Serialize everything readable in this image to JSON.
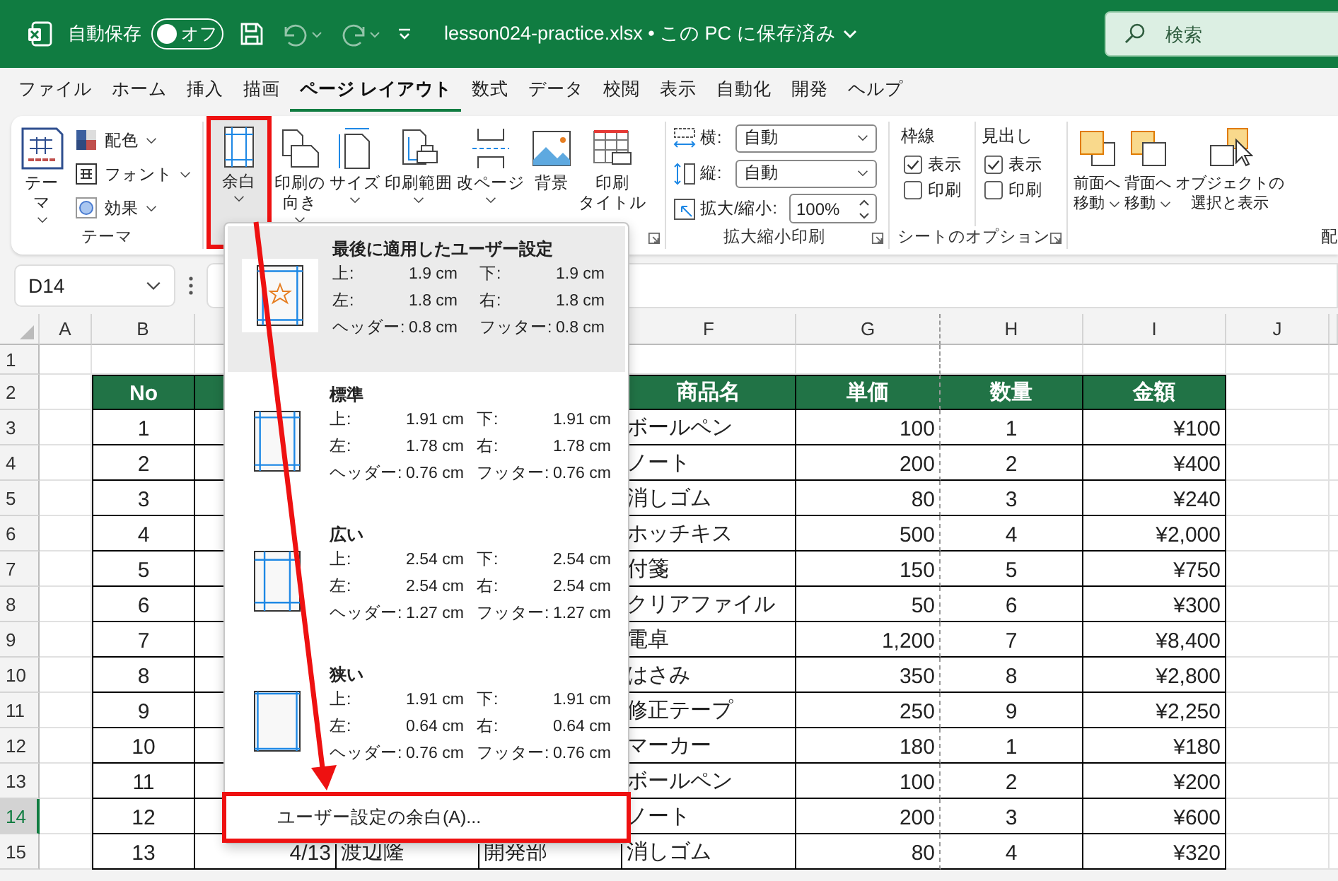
{
  "title_bar": {
    "autosave_label": "自動保存",
    "autosave": {
      "on": false,
      "state_label": "オフ"
    },
    "document": "lesson024-practice.xlsx • この PC に保存済み",
    "search": {
      "placeholder": "検索"
    }
  },
  "tabs": [
    {
      "label": "ファイル",
      "selected": false
    },
    {
      "label": "ホーム",
      "selected": false
    },
    {
      "label": "挿入",
      "selected": false
    },
    {
      "label": "描画",
      "selected": false
    },
    {
      "label": "ページ レイアウト",
      "selected": true
    },
    {
      "label": "数式",
      "selected": false
    },
    {
      "label": "データ",
      "selected": false
    },
    {
      "label": "校閲",
      "selected": false
    },
    {
      "label": "表示",
      "selected": false
    },
    {
      "label": "自動化",
      "selected": false
    },
    {
      "label": "開発",
      "selected": false
    },
    {
      "label": "ヘルプ",
      "selected": false
    }
  ],
  "ribbon": {
    "themes": {
      "big_button": "テーマ",
      "small_buttons": [
        "配色",
        "フォント",
        "効果"
      ],
      "label": "テーマ"
    },
    "page_setup": {
      "buttons": [
        {
          "lines": [
            "余白"
          ],
          "dropdown": true,
          "active": true
        },
        {
          "lines": [
            "印刷の",
            "向き"
          ],
          "dropdown": true,
          "active": false
        },
        {
          "lines": [
            "サイズ"
          ],
          "dropdown": true,
          "active": false
        },
        {
          "lines": [
            "印刷範囲"
          ],
          "dropdown": true,
          "active": false
        },
        {
          "lines": [
            "改ページ"
          ],
          "dropdown": true,
          "active": false
        },
        {
          "lines": [
            "背景"
          ],
          "dropdown": false,
          "active": false
        },
        {
          "lines": [
            "印刷",
            "タイトル"
          ],
          "dropdown": false,
          "active": false
        }
      ]
    },
    "scale": {
      "rows": [
        {
          "label": "横:",
          "value": "自動",
          "kind": "select"
        },
        {
          "label": "縦:",
          "value": "自動",
          "kind": "select"
        },
        {
          "label": "拡大/縮小:",
          "value": "100%",
          "kind": "spinner"
        }
      ],
      "label": "拡大縮小印刷"
    },
    "sheet_options": {
      "columns": [
        {
          "title": "枠線",
          "options": [
            {
              "label": "表示",
              "checked": true
            },
            {
              "label": "印刷",
              "checked": false
            }
          ]
        },
        {
          "title": "見出し",
          "options": [
            {
              "label": "表示",
              "checked": true
            },
            {
              "label": "印刷",
              "checked": false
            }
          ]
        }
      ],
      "label": "シートのオプション"
    },
    "arrange": {
      "buttons": [
        {
          "lines": [
            "前面へ",
            "移動"
          ],
          "dropdown": true
        },
        {
          "lines": [
            "背面へ",
            "移動"
          ],
          "dropdown": true
        },
        {
          "lines": [
            "オブジェクトの",
            "選択と表示"
          ],
          "dropdown": false
        }
      ],
      "label": "配"
    }
  },
  "formula_bar": {
    "name_box": "D14"
  },
  "sheet": {
    "column_headers": [
      "A",
      "B",
      "F",
      "G",
      "H",
      "I",
      "J"
    ],
    "rows": [
      {
        "num": "1",
        "kind": "blank",
        "selected": false
      },
      {
        "num": "2",
        "kind": "header",
        "selected": false,
        "no": "No",
        "product": "商品名",
        "price": "単価",
        "qty": "数量",
        "amount": "金額"
      },
      {
        "num": "3",
        "kind": "data",
        "selected": false,
        "no": "1",
        "product": "ボールペン",
        "price": "100",
        "qty": "1",
        "amount": "¥100"
      },
      {
        "num": "4",
        "kind": "data",
        "selected": false,
        "no": "2",
        "product": "ノート",
        "price": "200",
        "qty": "2",
        "amount": "¥400"
      },
      {
        "num": "5",
        "kind": "data",
        "selected": false,
        "no": "3",
        "product": "消しゴム",
        "price": "80",
        "qty": "3",
        "amount": "¥240"
      },
      {
        "num": "6",
        "kind": "data",
        "selected": false,
        "no": "4",
        "product": "ホッチキス",
        "price": "500",
        "qty": "4",
        "amount": "¥2,000"
      },
      {
        "num": "7",
        "kind": "data",
        "selected": false,
        "no": "5",
        "product": "付箋",
        "price": "150",
        "qty": "5",
        "amount": "¥750"
      },
      {
        "num": "8",
        "kind": "data",
        "selected": false,
        "no": "6",
        "product": "クリアファイル",
        "price": "50",
        "qty": "6",
        "amount": "¥300"
      },
      {
        "num": "9",
        "kind": "data",
        "selected": false,
        "no": "7",
        "product": "電卓",
        "price": "1,200",
        "qty": "7",
        "amount": "¥8,400"
      },
      {
        "num": "10",
        "kind": "data",
        "selected": false,
        "no": "8",
        "product": "はさみ",
        "price": "350",
        "qty": "8",
        "amount": "¥2,800"
      },
      {
        "num": "11",
        "kind": "data",
        "selected": false,
        "no": "9",
        "product": "修正テープ",
        "price": "250",
        "qty": "9",
        "amount": "¥2,250"
      },
      {
        "num": "12",
        "kind": "data",
        "selected": false,
        "no": "10",
        "product": "マーカー",
        "price": "180",
        "qty": "1",
        "amount": "¥180"
      },
      {
        "num": "13",
        "kind": "data",
        "selected": false,
        "no": "11",
        "product": "ボールペン",
        "price": "100",
        "qty": "2",
        "amount": "¥200"
      },
      {
        "num": "14",
        "kind": "data",
        "selected": true,
        "no": "12",
        "product": "ノート",
        "price": "200",
        "qty": "3",
        "amount": "¥600"
      },
      {
        "num": "15",
        "kind": "data",
        "selected": false,
        "no": "13",
        "date": "4/13",
        "name": "渡辺隆",
        "dept": "開発部",
        "product": "消しゴム",
        "price": "80",
        "qty": "4",
        "amount": "¥320"
      }
    ]
  },
  "margins_menu": {
    "presets": [
      {
        "kind": "custom",
        "title": "最後に適用したユーザー設定",
        "selected": true,
        "rows": [
          {
            "label": "上:",
            "value": "1.9 cm",
            "label2": "下:",
            "value2": "1.9 cm"
          },
          {
            "label": "左:",
            "value": "1.8 cm",
            "label2": "右:",
            "value2": "1.8 cm"
          },
          {
            "label": "ヘッダー:",
            "value": "0.8 cm",
            "label2": "フッター:",
            "value2": "0.8 cm"
          }
        ]
      },
      {
        "kind": "standard",
        "title": "標準",
        "selected": false,
        "rows": [
          {
            "label": "上:",
            "value": "1.91 cm",
            "label2": "下:",
            "value2": "1.91 cm"
          },
          {
            "label": "左:",
            "value": "1.78 cm",
            "label2": "右:",
            "value2": "1.78 cm"
          },
          {
            "label": "ヘッダー:",
            "value": "0.76 cm",
            "label2": "フッター:",
            "value2": "0.76 cm"
          }
        ]
      },
      {
        "kind": "wide",
        "title": "広い",
        "selected": false,
        "rows": [
          {
            "label": "上:",
            "value": "2.54 cm",
            "label2": "下:",
            "value2": "2.54 cm"
          },
          {
            "label": "左:",
            "value": "2.54 cm",
            "label2": "右:",
            "value2": "2.54 cm"
          },
          {
            "label": "ヘッダー:",
            "value": "1.27 cm",
            "label2": "フッター:",
            "value2": "1.27 cm"
          }
        ]
      },
      {
        "kind": "narrow",
        "title": "狭い",
        "selected": false,
        "rows": [
          {
            "label": "上:",
            "value": "1.91 cm",
            "label2": "下:",
            "value2": "1.91 cm"
          },
          {
            "label": "左:",
            "value": "0.64 cm",
            "label2": "右:",
            "value2": "0.64 cm"
          },
          {
            "label": "ヘッダー:",
            "value": "0.76 cm",
            "label2": "フッター:",
            "value2": "0.76 cm"
          }
        ]
      }
    ],
    "custom_item": "ユーザー設定の余白(A)..."
  }
}
